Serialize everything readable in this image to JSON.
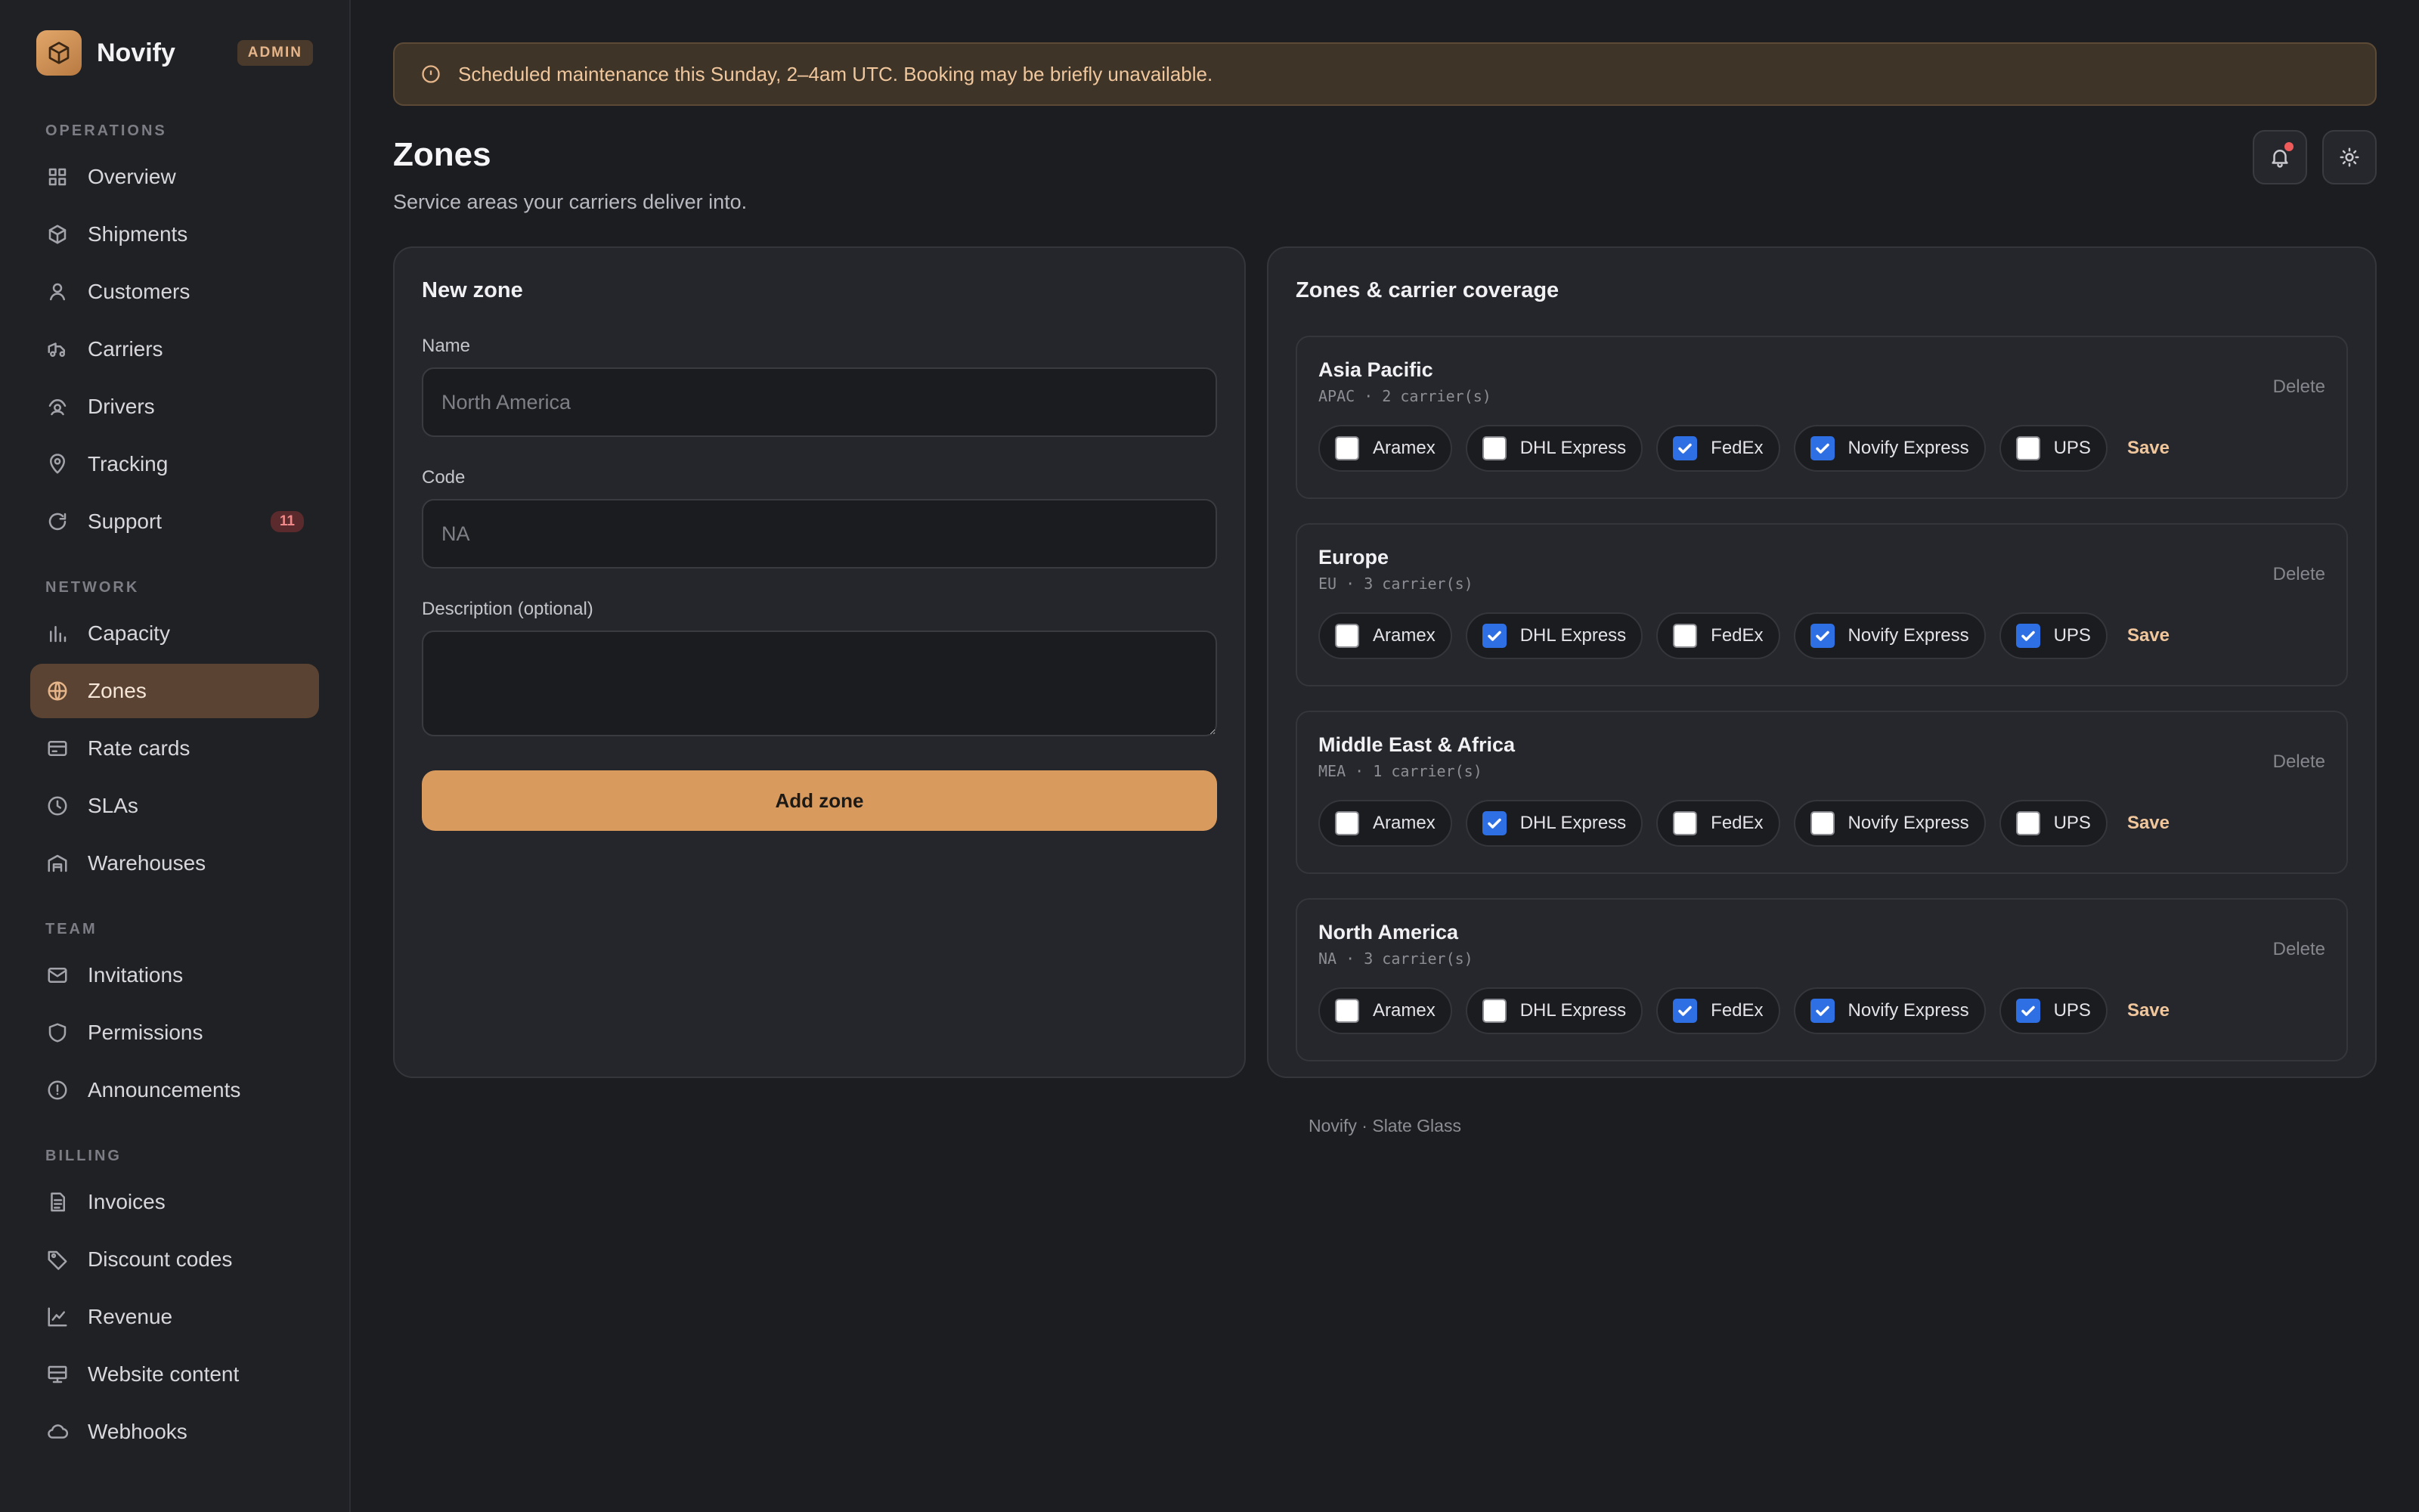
{
  "brand": {
    "name": "Novify",
    "badge": "ADMIN"
  },
  "sidebar": {
    "sections": [
      {
        "title": "OPERATIONS",
        "items": [
          {
            "label": "Overview",
            "icon": "grid-icon"
          },
          {
            "label": "Shipments",
            "icon": "box-icon"
          },
          {
            "label": "Customers",
            "icon": "user-icon"
          },
          {
            "label": "Carriers",
            "icon": "truck-icon"
          },
          {
            "label": "Drivers",
            "icon": "driver-icon"
          },
          {
            "label": "Tracking",
            "icon": "map-pin-icon"
          },
          {
            "label": "Support",
            "icon": "refresh-icon",
            "count": "11"
          }
        ]
      },
      {
        "title": "NETWORK",
        "items": [
          {
            "label": "Capacity",
            "icon": "bar-chart-icon"
          },
          {
            "label": "Zones",
            "icon": "globe-icon",
            "active": true
          },
          {
            "label": "Rate cards",
            "icon": "card-icon"
          },
          {
            "label": "SLAs",
            "icon": "clock-icon"
          },
          {
            "label": "Warehouses",
            "icon": "warehouse-icon"
          }
        ]
      },
      {
        "title": "TEAM",
        "items": [
          {
            "label": "Invitations",
            "icon": "mail-icon"
          },
          {
            "label": "Permissions",
            "icon": "shield-icon"
          },
          {
            "label": "Announcements",
            "icon": "alert-circle-icon"
          }
        ]
      },
      {
        "title": "BILLING",
        "items": [
          {
            "label": "Invoices",
            "icon": "file-icon"
          },
          {
            "label": "Discount codes",
            "icon": "tag-icon"
          },
          {
            "label": "Revenue",
            "icon": "line-chart-icon"
          },
          {
            "label": "Website content",
            "icon": "monitor-icon"
          },
          {
            "label": "Webhooks",
            "icon": "cloud-icon"
          }
        ]
      }
    ]
  },
  "banner": {
    "text": "Scheduled maintenance this Sunday, 2–4am UTC. Booking may be briefly unavailable."
  },
  "page": {
    "title": "Zones",
    "subtitle": "Service areas your carriers deliver into."
  },
  "form": {
    "title": "New zone",
    "name_label": "Name",
    "name_placeholder": "North America",
    "code_label": "Code",
    "code_placeholder": "NA",
    "description_label": "Description (optional)",
    "submit_label": "Add zone"
  },
  "coverage": {
    "title": "Zones & carrier coverage",
    "delete_label": "Delete",
    "save_label": "Save",
    "zones": [
      {
        "name": "Asia Pacific",
        "meta": "APAC · 2 carrier(s)",
        "carriers": [
          {
            "label": "Aramex",
            "checked": false
          },
          {
            "label": "DHL Express",
            "checked": false
          },
          {
            "label": "FedEx",
            "checked": true
          },
          {
            "label": "Novify Express",
            "checked": true
          },
          {
            "label": "UPS",
            "checked": false
          }
        ]
      },
      {
        "name": "Europe",
        "meta": "EU · 3 carrier(s)",
        "carriers": [
          {
            "label": "Aramex",
            "checked": false
          },
          {
            "label": "DHL Express",
            "checked": true
          },
          {
            "label": "FedEx",
            "checked": false
          },
          {
            "label": "Novify Express",
            "checked": true
          },
          {
            "label": "UPS",
            "checked": true
          }
        ]
      },
      {
        "name": "Middle East & Africa",
        "meta": "MEA · 1 carrier(s)",
        "carriers": [
          {
            "label": "Aramex",
            "checked": false
          },
          {
            "label": "DHL Express",
            "checked": true
          },
          {
            "label": "FedEx",
            "checked": false
          },
          {
            "label": "Novify Express",
            "checked": false
          },
          {
            "label": "UPS",
            "checked": false
          }
        ]
      },
      {
        "name": "North America",
        "meta": "NA · 3 carrier(s)",
        "carriers": [
          {
            "label": "Aramex",
            "checked": false
          },
          {
            "label": "DHL Express",
            "checked": false
          },
          {
            "label": "FedEx",
            "checked": true
          },
          {
            "label": "Novify Express",
            "checked": true
          },
          {
            "label": "UPS",
            "checked": true
          }
        ]
      }
    ]
  },
  "footer": {
    "text": "Novify · Slate Glass"
  },
  "colors": {
    "accent": "#d99a5e",
    "checkbox": "#2f6fe4",
    "alert_dot": "#ef5b5b"
  }
}
